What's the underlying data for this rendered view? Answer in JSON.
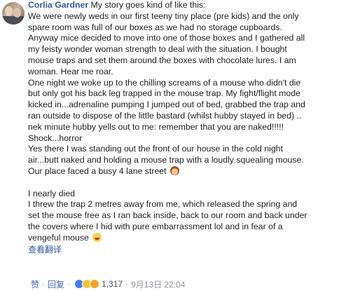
{
  "comment": {
    "author": "Corlia Gardner",
    "lines": [
      "My story goes kind of like this:",
      "We were newly weds in our first teeny tiny place (pre kids) and the only",
      "spare room was full of our boxes as we had no storage cupboards.",
      "Anyway mice decided to move into one of those boxes and I gathered all",
      "my feisty wonder woman strength to deal with the situation. I bought",
      "mouse traps and set them around the boxes with chocolate lures. I am",
      "woman. Hear me roar.",
      "One night we woke up to the chilling screams of a mouse who didn't die",
      "but only got his back leg trapped in the mouse trap. My fight/flight mode",
      "kicked in...adrenaline pumping I jumped out of bed, grabbed the trap and",
      "ran outside to dispose of the little bastard (whilst hubby stayed in bed) ..",
      "nek minute hubby yells out to me: remember that you are naked!!!!!",
      "Shock...horror",
      "Yes there I was standing out the front of our house in the cold night",
      "air...butt naked and holding a mouse trap with a loudly squealing mouse.",
      "Our place faced a busy 4 lane street",
      "",
      "I nearly died",
      "I threw the trap 2 metres away from me, which released the spring and",
      "set the mouse free as I ran back inside, back to our room and back under",
      "the covers where I hid with pure embarrassment lol and in fear of a",
      "vengeful mouse"
    ],
    "emoji_line15": "woman-emoji",
    "emoji_line21": "laughing-emoji",
    "see_translation": "查看翻译"
  },
  "footer": {
    "like_label": "赞",
    "separator": "·",
    "reply_label": "回复",
    "reaction_count": "1,317",
    "timestamp": "9月13日 22:04",
    "reaction_icons": [
      "like-icon",
      "haha-icon",
      "wow-icon"
    ]
  },
  "colors": {
    "author": "#365899",
    "link": "#4267b2",
    "text": "#1c1e21",
    "meta": "#90949c"
  }
}
